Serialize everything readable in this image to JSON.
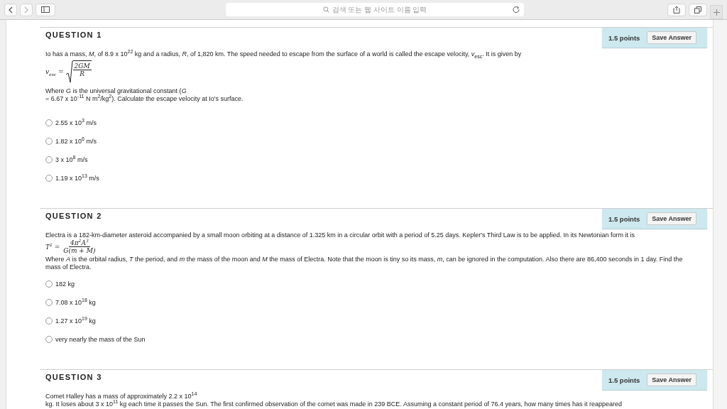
{
  "browser": {
    "address_placeholder": "검색 또는 웹 사이트 이름 입력"
  },
  "questions": [
    {
      "title": "QUESTION 1",
      "points": "1.5 points",
      "button": "Save Answer",
      "text": "Io has a mass, *M*, of 8.9 x 10$^{22}$ kg and a radius, *R*, of 1,820 km. The speed needed to escape from the surface of a world is called the escape velocity, *v*$_{esc}$. It is given by",
      "formula": {
        "kind": "sqrt",
        "lhs": "v$_{esc}$ =",
        "numerator": "2GM",
        "denominator": "R"
      },
      "after": [
        "Where *G* is the universal gravitational constant (*G*",
        "= 6.67 x 10$^{-11}$ N m$^{2}$/kg$^{2}$). Calculate the escape velocity at Io's surface."
      ],
      "options": [
        {
          "label": "2.55 x 10$^{3}$ m/s",
          "selected": false
        },
        {
          "label": "1.82 x 10$^{6}$ m/s",
          "selected": false
        },
        {
          "label": "3 x 10$^{8}$ m/s",
          "selected": false
        },
        {
          "label": "1.19 x 10$^{13}$ m/s",
          "selected": false
        }
      ]
    },
    {
      "title": "QUESTION 2",
      "points": "1.5 points",
      "button": "Save Answer",
      "text": "Electra is a 182-km-diameter asteroid accompanied by a small moon orbiting at a distance of 1.325 km in a circular orbit with a period of 5.25 days. Kepler's Third Law is to be applied. In its Newtonian form it is",
      "formula": {
        "kind": "fraction",
        "lhs": "T$^{2}$ =",
        "numerator": "4π$^{2}$A$^{3}$",
        "denominator": "G(m + M)"
      },
      "after": [
        "Where *A* is the orbital radius, *T* the period, and *m* the mass of the moon and *M* the mass of Electra. Note that the moon is tiny so its mass, *m*, can be ignored in the computation. Also there are 86,400 seconds in 1 day. Find the mass of Electra."
      ],
      "options": [
        {
          "label": "182 kg",
          "selected": false
        },
        {
          "label": "7.08 x 10$^{18}$ kg",
          "selected": false
        },
        {
          "label": "1.27 x 10$^{19}$ kg",
          "selected": false
        },
        {
          "label": "very nearly the mass of the Sun",
          "selected": false
        }
      ]
    },
    {
      "title": "QUESTION 3",
      "points": "1.5 points",
      "button": "Save Answer",
      "text": "Comet Halley has a mass of approximately 2.2 x 10$^{14}$",
      "after": [
        "kg. It loses about 3 x 10$^{11}$ kg each time it passes the Sun. The first confirmed observation of the comet was made in 239 BCE. Assuming a constant period of 76.4 years, how many times has it reappeared"
      ]
    }
  ]
}
